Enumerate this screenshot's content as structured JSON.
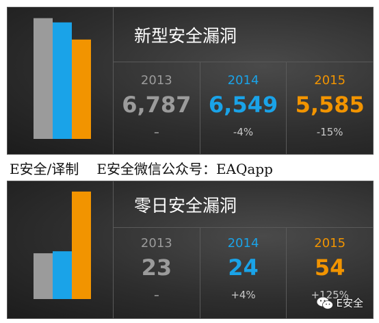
{
  "top": {
    "title": "新型安全漏洞",
    "stats": [
      {
        "year": "2013",
        "value": "6,787",
        "change": "–"
      },
      {
        "year": "2014",
        "value": "6,549",
        "change": "-4%"
      },
      {
        "year": "2015",
        "value": "5,585",
        "change": "-15%"
      }
    ]
  },
  "caption": {
    "left": "E安全/译制",
    "right": "E安全微信公众号：EAQapp"
  },
  "bottom": {
    "title": "零日安全漏洞",
    "stats": [
      {
        "year": "2013",
        "value": "23",
        "change": "–"
      },
      {
        "year": "2014",
        "value": "24",
        "change": "+4%"
      },
      {
        "year": "2015",
        "value": "54",
        "change": "+125%"
      }
    ]
  },
  "watermark": {
    "label": "E安全",
    "icon": "wechat-icon"
  },
  "colors": {
    "y2013": "#9b9b9b",
    "y2014": "#1aa3e8",
    "y2015": "#f29400"
  },
  "chart_data": [
    {
      "type": "bar",
      "title": "新型安全漏洞",
      "categories": [
        "2013",
        "2014",
        "2015"
      ],
      "values": [
        6787,
        6549,
        5585
      ],
      "ylim": [
        0,
        7000
      ],
      "colors": [
        "#9b9b9b",
        "#1aa3e8",
        "#f29400"
      ]
    },
    {
      "type": "bar",
      "title": "零日安全漏洞",
      "categories": [
        "2013",
        "2014",
        "2015"
      ],
      "values": [
        23,
        24,
        54
      ],
      "ylim": [
        0,
        55
      ],
      "colors": [
        "#9b9b9b",
        "#1aa3e8",
        "#f29400"
      ]
    }
  ]
}
